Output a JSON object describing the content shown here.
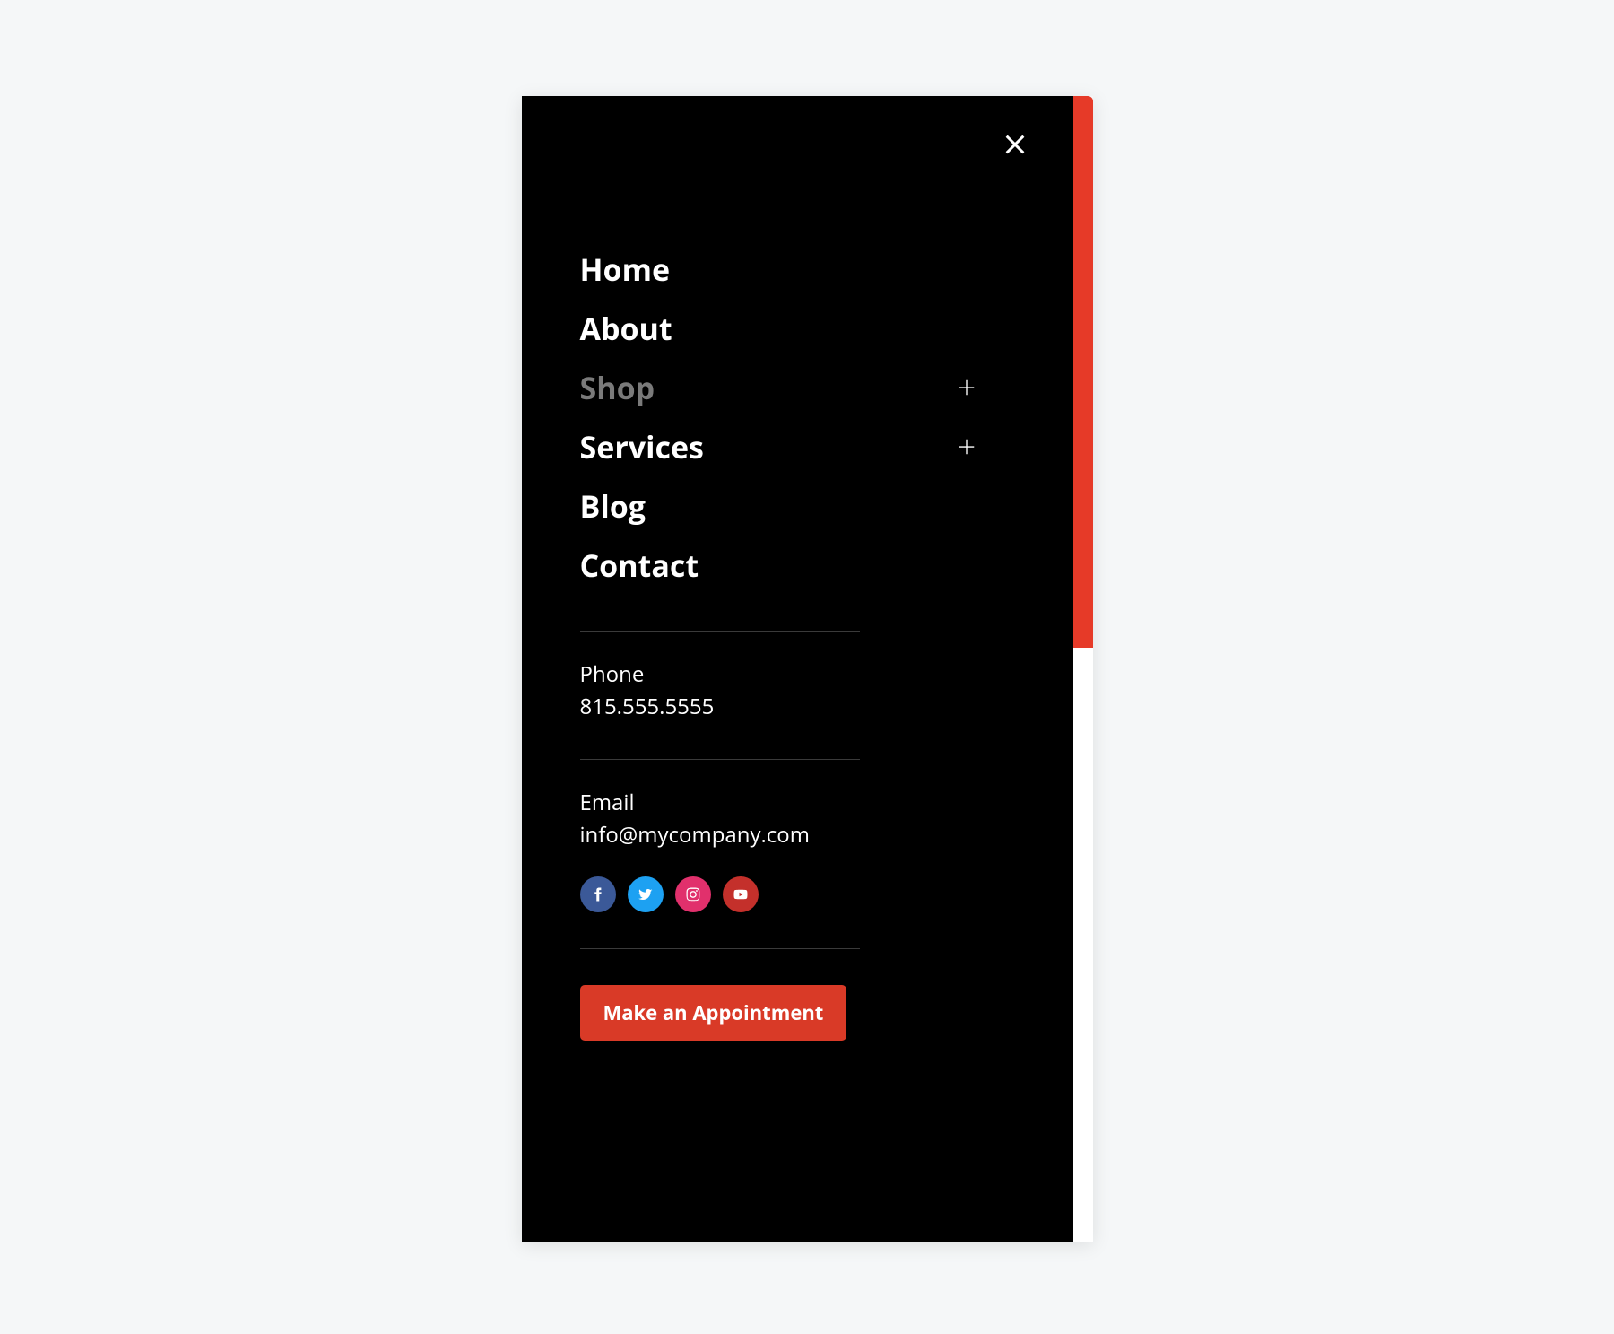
{
  "nav": {
    "items": [
      {
        "label": "Home",
        "expandable": false,
        "disabled": false
      },
      {
        "label": "About",
        "expandable": false,
        "disabled": false
      },
      {
        "label": "Shop",
        "expandable": true,
        "disabled": true
      },
      {
        "label": "Services",
        "expandable": true,
        "disabled": false
      },
      {
        "label": "Blog",
        "expandable": false,
        "disabled": false
      },
      {
        "label": "Contact",
        "expandable": false,
        "disabled": false
      }
    ]
  },
  "contact": {
    "phone_label": "Phone",
    "phone_value": "815.555.5555",
    "email_label": "Email",
    "email_value": "info@mycompany.com"
  },
  "social": {
    "facebook": "facebook",
    "twitter": "twitter",
    "instagram": "instagram",
    "youtube": "youtube"
  },
  "cta": {
    "label": "Make an Appointment"
  },
  "colors": {
    "accent": "#d93a27",
    "scrollbar": "#e63a28"
  }
}
